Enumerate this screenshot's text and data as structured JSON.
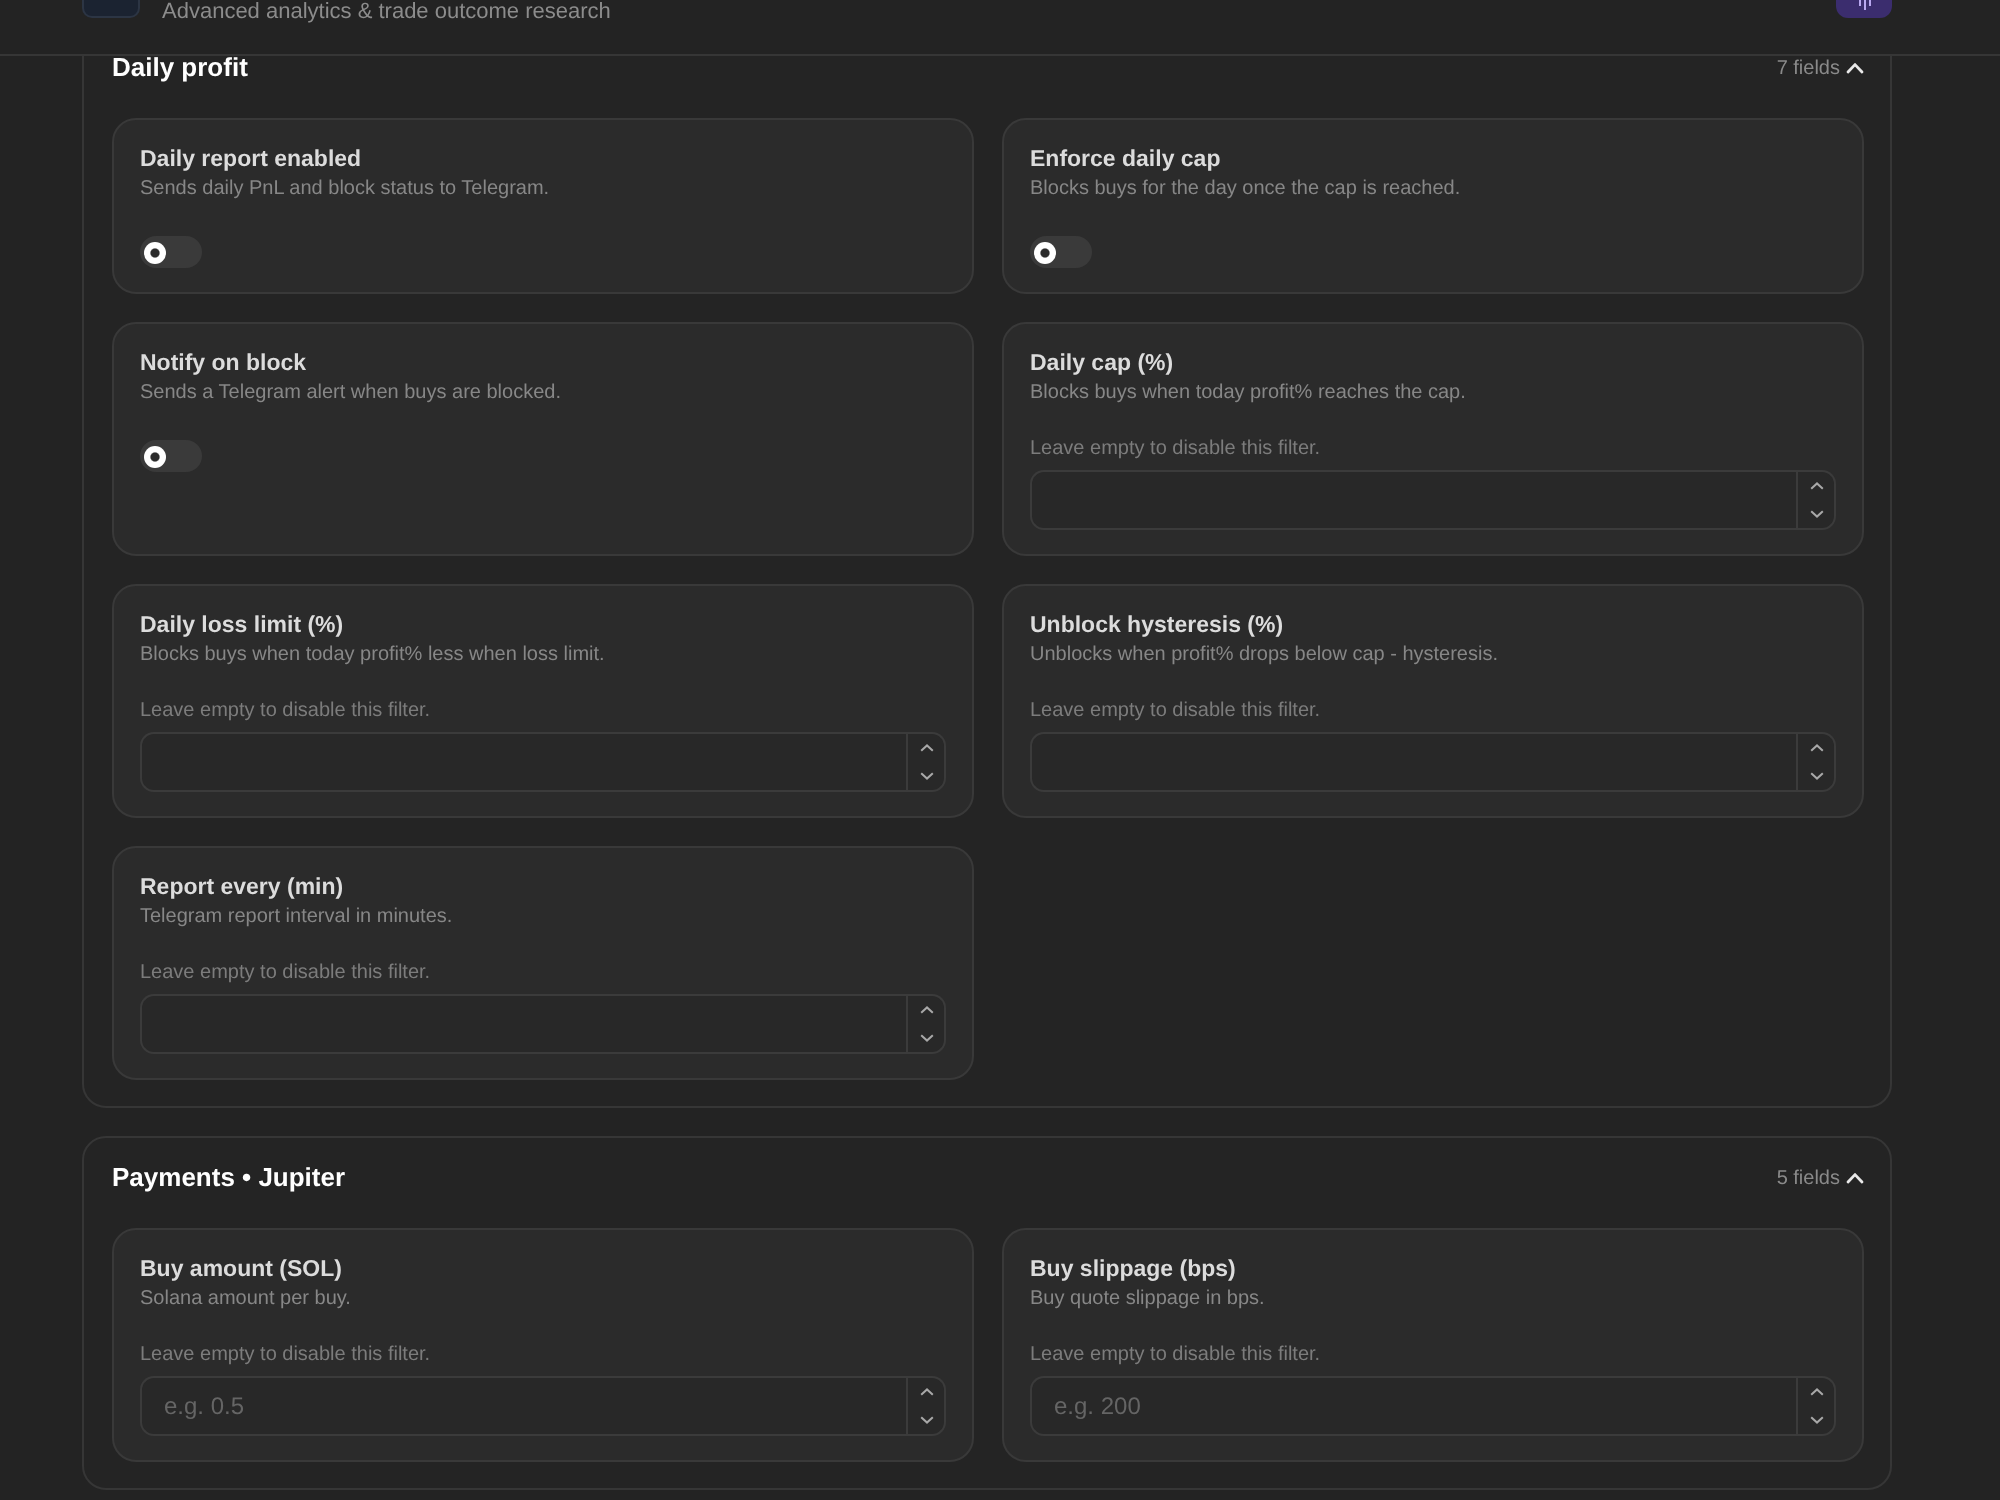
{
  "header": {
    "subtitle": "Advanced analytics & trade outcome research"
  },
  "sections": [
    {
      "title": "Daily profit",
      "count": "7 fields",
      "expanded": true,
      "fields": [
        {
          "kind": "toggle",
          "title": "Daily report enabled",
          "description": "Sends daily PnL and block status to Telegram.",
          "checked": false
        },
        {
          "kind": "toggle",
          "title": "Enforce daily cap",
          "description": "Blocks buys for the day once the cap is reached.",
          "checked": false
        },
        {
          "kind": "toggle",
          "title": "Notify on block",
          "description": "Sends a Telegram alert when buys are blocked.",
          "checked": false
        },
        {
          "kind": "number",
          "title": "Daily cap (%)",
          "description": "Blocks buys when today profit% reaches the cap.",
          "hint": "Leave empty to disable this filter."
        },
        {
          "kind": "number",
          "title": "Daily loss limit (%)",
          "description": "Blocks buys when today profit% less when loss limit.",
          "hint": "Leave empty to disable this filter."
        },
        {
          "kind": "number",
          "title": "Unblock hysteresis (%)",
          "description": "Unblocks when profit% drops below cap - hysteresis.",
          "hint": "Leave empty to disable this filter."
        },
        {
          "kind": "number",
          "title": "Report every (min)",
          "description": "Telegram report interval in minutes.",
          "hint": "Leave empty to disable this filter."
        }
      ]
    },
    {
      "title": "Payments • Jupiter",
      "count": "5 fields",
      "expanded": true,
      "fields": [
        {
          "kind": "number",
          "title": "Buy amount (SOL)",
          "description": "Solana amount per buy.",
          "hint": "Leave empty to disable this filter.",
          "placeholder": "e.g. 0.5"
        },
        {
          "kind": "number",
          "title": "Buy slippage (bps)",
          "description": "Buy quote slippage in bps.",
          "hint": "Leave empty to disable this filter.",
          "placeholder": "e.g. 200"
        }
      ]
    }
  ]
}
